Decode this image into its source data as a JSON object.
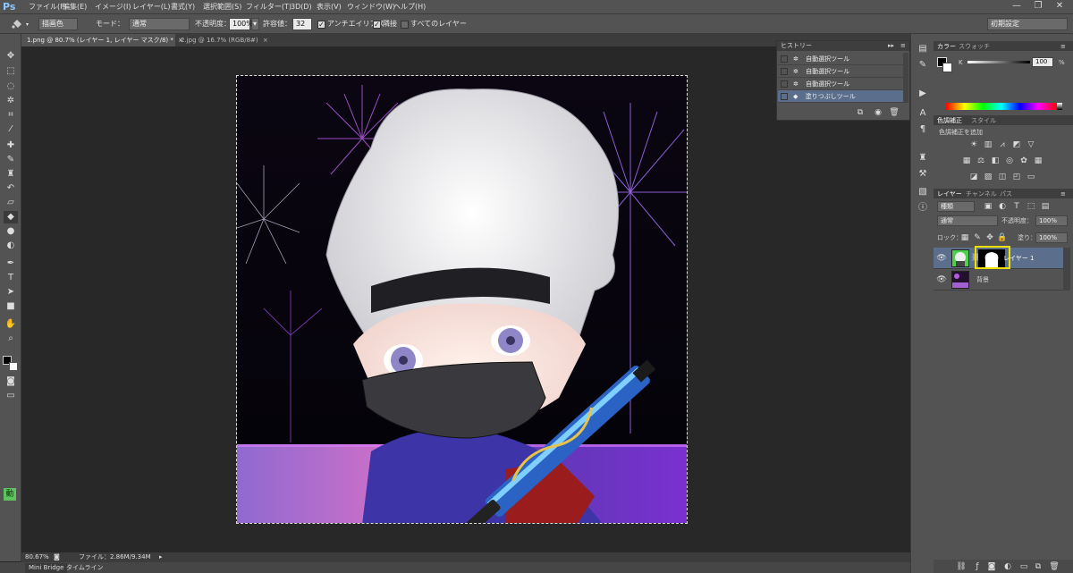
{
  "app": {
    "logo": "Ps"
  },
  "menu": [
    "ファイル(F)",
    "編集(E)",
    "イメージ(I)",
    "レイヤー(L)",
    "書式(Y)",
    "選択範囲(S)",
    "フィルター(T)",
    "3D(D)",
    "表示(V)",
    "ウィンドウ(W)",
    "ヘルプ(H)"
  ],
  "window_controls": {
    "minimize": "—",
    "restore": "❐",
    "close": "✕"
  },
  "options": {
    "fill_source": "描画色",
    "mode_label": "モード：",
    "mode_value": "通常",
    "opacity_label": "不透明度：",
    "opacity_value": "100%",
    "tolerance_label": "許容値：",
    "tolerance_value": "32",
    "antialias_label": "アンチエイリアス",
    "antialias_checked": true,
    "contiguous_label": "隣接",
    "contiguous_checked": true,
    "all_layers_label": "すべてのレイヤー",
    "all_layers_checked": false,
    "workspace": "初期設定"
  },
  "doc_tabs": [
    {
      "label": "1.png @ 80.7% (レイヤー 1, レイヤー マスク/8) *",
      "active": true,
      "close": "×"
    },
    {
      "label": "2.jpg @ 16.7% (RGB/8#)",
      "active": false,
      "close": "×"
    }
  ],
  "history": {
    "tab": "ヒストリー",
    "items": [
      "自動選択ツール",
      "自動選択ツール",
      "自動選択ツール",
      "塗りつぶしツール"
    ],
    "selected_index": 3
  },
  "color_panel": {
    "tabs": [
      "カラー",
      "スウォッチ"
    ],
    "channel_label": "K",
    "value": "100",
    "unit": "%"
  },
  "adjustments": {
    "tabs": [
      "色調補正",
      "スタイル"
    ],
    "hint": "色調補正を追加"
  },
  "layers": {
    "tabs": [
      "レイヤー",
      "チャンネル",
      "パス"
    ],
    "filter_label": "種類",
    "blend_mode": "通常",
    "opacity_label": "不透明度：",
    "opacity_value": "100%",
    "lock_label": "ロック：",
    "fill_label": "塗り：",
    "fill_value": "100%",
    "items": [
      {
        "name": "レイヤー 1",
        "selected": true,
        "has_mask": true
      },
      {
        "name": "背景",
        "selected": false,
        "has_mask": false
      }
    ]
  },
  "status": {
    "zoom": "80.67%",
    "file_info": "ファイル：2.86M/9.34M"
  },
  "bottom_tabs": [
    "Mini Bridge",
    "タイムライン"
  ],
  "colors": {
    "accent_highlight": "#e8d900",
    "selected_row": "#5b6f8c",
    "mask_indicator": "#f0e000"
  }
}
